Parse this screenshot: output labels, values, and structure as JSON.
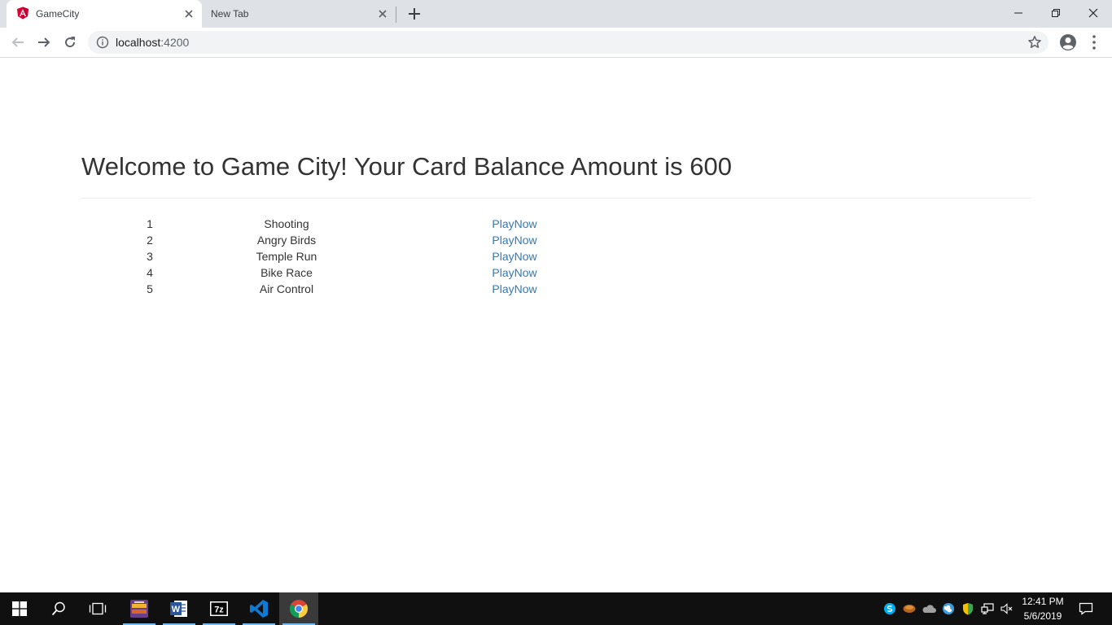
{
  "browser": {
    "tabs": [
      {
        "title": "GameCity",
        "favicon": "angular-icon",
        "active": true
      },
      {
        "title": "New Tab",
        "active": false
      }
    ],
    "address": {
      "host": "localhost",
      "port": ":4200"
    }
  },
  "page": {
    "heading": "Welcome to Game City! Your Card Balance Amount is 600",
    "games": [
      {
        "id": "1",
        "name": "Shooting",
        "action": "PlayNow"
      },
      {
        "id": "2",
        "name": "Angry Birds",
        "action": "PlayNow"
      },
      {
        "id": "3",
        "name": "Temple Run",
        "action": "PlayNow"
      },
      {
        "id": "4",
        "name": "Bike Race",
        "action": "PlayNow"
      },
      {
        "id": "5",
        "name": "Air Control",
        "action": "PlayNow"
      }
    ],
    "colors": {
      "link": "#337ab7",
      "text": "#333333"
    }
  },
  "taskbar": {
    "time": "12:41 PM",
    "date": "5/6/2019",
    "apps": [
      "game-app-icon",
      "word-icon",
      "7zip-icon",
      "vscode-icon",
      "chrome-icon"
    ],
    "seven_zip_label": "7z",
    "word_label": "W"
  }
}
